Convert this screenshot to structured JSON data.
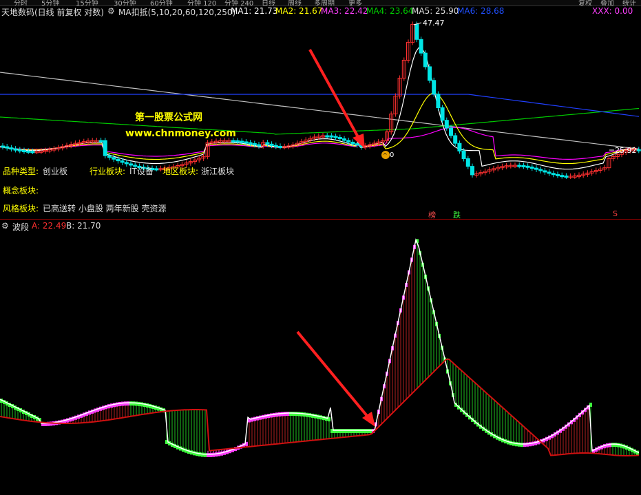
{
  "toolbar": {
    "tabs": [
      "分时",
      "5分钟",
      "15分钟",
      "30分钟",
      "60分钟",
      "分钟 120",
      "分钟 240",
      "日线",
      "周线",
      "多周期",
      "更多"
    ],
    "right_buttons": [
      "复权",
      "叠加",
      "统计"
    ]
  },
  "main_chart": {
    "stock_title": "天地数码(日线 前复权 对数)",
    "indicator_name": "MA扣抵(5,10,20,60,120,250)",
    "ma1": "MA1: 21.73",
    "ma2": "MA2: 21.67",
    "ma3": "MA3: 22.42",
    "ma4": "MA4: 23.64",
    "ma5": "MA5: 25.90",
    "ma6": "MA6: 28.68",
    "xxx": "XXX: 0.00",
    "peak_label": "47.47",
    "last_price_label": "25.92",
    "marker_zero": "0",
    "watermark_name": "第一股票公式网",
    "watermark_url": "www.chnmoney.com",
    "info_type_label": "品种类型:",
    "info_type_value": "创业板",
    "info_industry_label": "行业板块:",
    "info_industry_value": "IT设备",
    "info_region_label": "地区板块:",
    "info_region_value": "浙江板块",
    "info_concept_label": "概念板块:",
    "info_style_label": "风格板块:",
    "info_style_value": "已高送转 小盘股 两年新股 壳资源",
    "tag_bang": "榜",
    "tag_die": "跌",
    "tag_s": "S"
  },
  "sub_chart": {
    "name": "波段",
    "a_value": "A: 22.49",
    "b_value": "B: 21.70"
  },
  "colors": {
    "up": "#ff3030",
    "down": "#00e5e5",
    "ma1": "#ffffff",
    "ma2": "#ffff00",
    "ma3": "#ff00ff",
    "ma4": "#00cc00",
    "ma5": "#c0c0c0",
    "ma6": "#2040ff",
    "wave_up": "#ff40ff",
    "wave_down": "#40ff40",
    "wave_red": "#d01010",
    "arrow": "#ff2020"
  }
}
